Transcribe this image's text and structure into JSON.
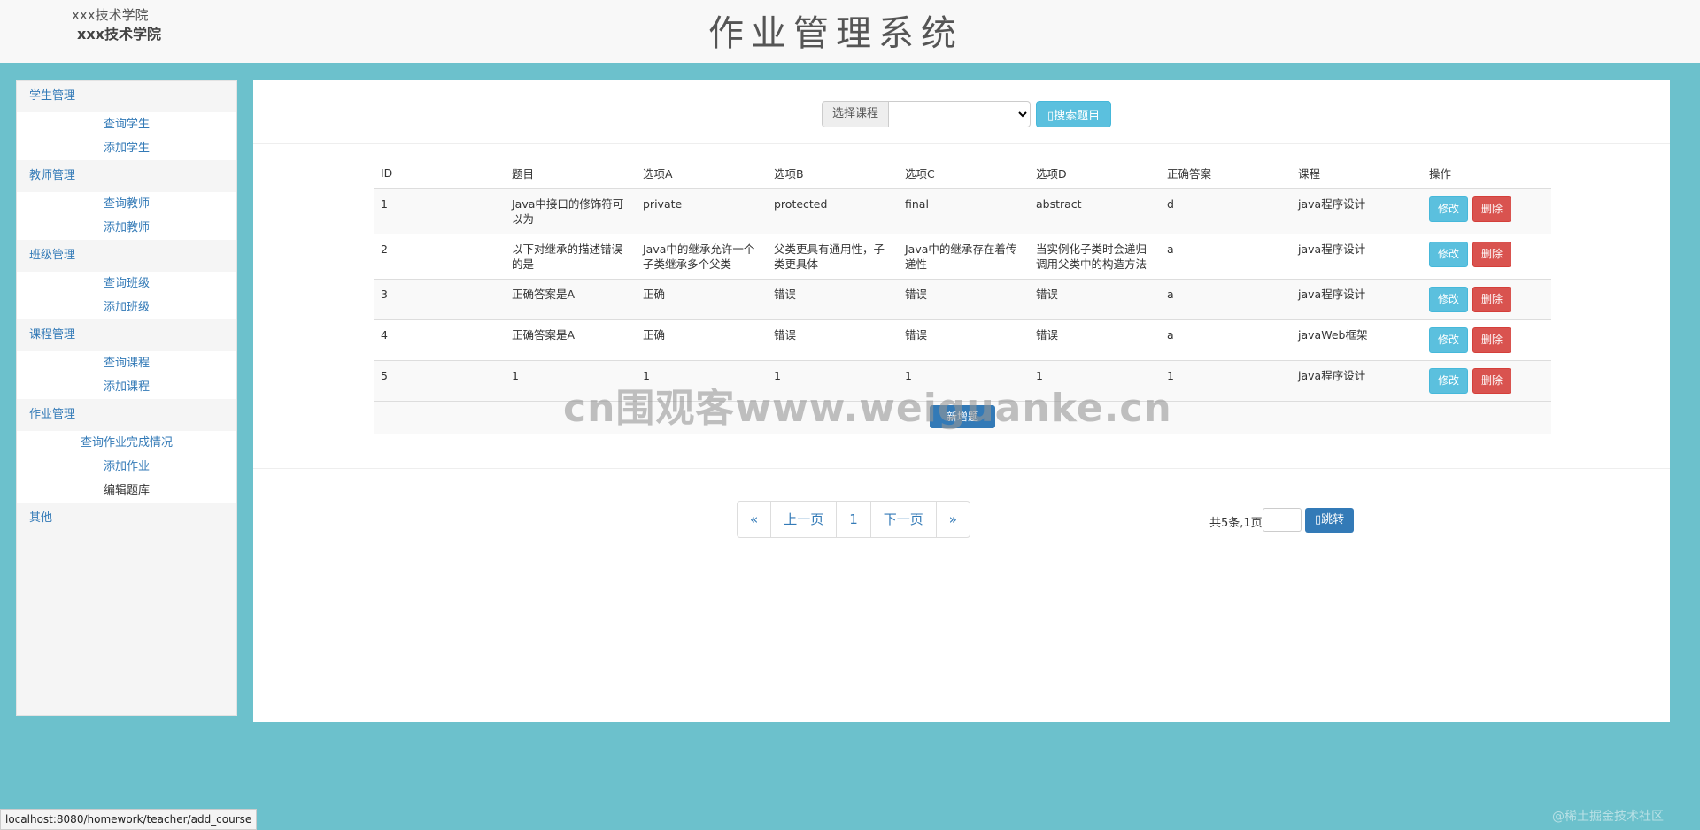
{
  "header": {
    "logo_alt": "xxx技术学院",
    "logo_name": "xxx技术学院",
    "title": "作业管理系统"
  },
  "sidebar": {
    "groups": [
      {
        "label": "学生管理",
        "items": [
          "查询学生",
          "添加学生"
        ]
      },
      {
        "label": "教师管理",
        "items": [
          "查询教师",
          "添加教师"
        ]
      },
      {
        "label": "班级管理",
        "items": [
          "查询班级",
          "添加班级"
        ]
      },
      {
        "label": "课程管理",
        "items": [
          "查询课程",
          "添加课程"
        ]
      },
      {
        "label": "作业管理",
        "items": [
          "查询作业完成情况",
          "添加作业",
          "编辑题库"
        ]
      },
      {
        "label": "其他",
        "items": []
      }
    ],
    "active_item": "编辑题库"
  },
  "search": {
    "addon_label": "选择课程",
    "selected_course": "",
    "button_label": "搜索题目"
  },
  "table": {
    "columns": [
      "ID",
      "题目",
      "选项A",
      "选项B",
      "选项C",
      "选项D",
      "正确答案",
      "课程",
      "操作"
    ],
    "rows": [
      [
        "1",
        "Java中接口的修饰符可以为",
        "private",
        "protected",
        "final",
        "abstract",
        "d",
        "java程序设计"
      ],
      [
        "2",
        "以下对继承的描述错误的是",
        "Java中的继承允许一个子类继承多个父类",
        "父类更具有通用性，子类更具体",
        "Java中的继承存在着传递性",
        "当实例化子类时会递归调用父类中的构造方法",
        "a",
        "java程序设计"
      ],
      [
        "3",
        "正确答案是A",
        "正确",
        "错误",
        "错误",
        "错误",
        "a",
        "java程序设计"
      ],
      [
        "4",
        "正确答案是A",
        "正确",
        "错误",
        "错误",
        "错误",
        "a",
        "javaWeb框架"
      ],
      [
        "5",
        "1",
        "1",
        "1",
        "1",
        "1",
        "1",
        "java程序设计"
      ]
    ],
    "edit_label": "修改",
    "delete_label": "删除",
    "add_label": "新增题"
  },
  "pagination": {
    "first": "«",
    "prev": "上一页",
    "current": "1",
    "next": "下一页",
    "last": "»",
    "info": "共5条,1页",
    "jump_label": "跳转"
  },
  "watermark": "cn围观客www.weiguanke.cn",
  "status_url": "localhost:8080/homework/teacher/add_course",
  "corner_mark": "@稀土掘金技术社区"
}
